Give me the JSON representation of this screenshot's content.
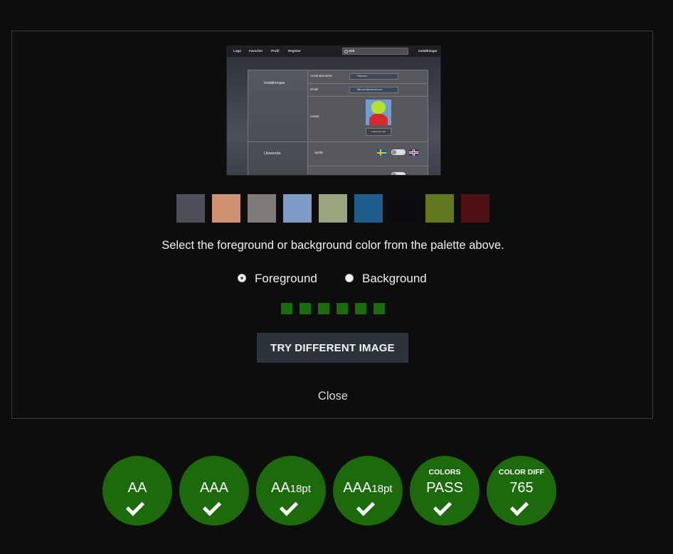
{
  "preview": {
    "nav": [
      "Logo",
      "Favoriter",
      "Profil",
      "Register"
    ],
    "search_value": "Sök",
    "settings_link": "Inställningar",
    "section_settings": "Inställningar",
    "section_appearance": "Utseende",
    "username_label": "Användarnamn",
    "username_value": "Fillmonio",
    "email_label": "Email",
    "email_value": "fillmonio@hotmail.com",
    "avatar_label": "Avatar",
    "avatar_button": "Ladda upp bild",
    "language_label": "Språk"
  },
  "palette": [
    "#4d5157",
    "#d09173",
    "#7f7979",
    "#7c9cc6",
    "#99a57e",
    "#1e5e8c",
    "#0b0c12",
    "#62781e",
    "#4e0f11"
  ],
  "instruction": "Select the foreground or background color from the palette above.",
  "radios": {
    "foreground": "Foreground",
    "background": "Background",
    "selected": "foreground"
  },
  "indicator_count": 6,
  "try_button": "TRY DIFFERENT IMAGE",
  "close": "Close",
  "badges": [
    {
      "label": "AA",
      "suffix": "",
      "sub": "",
      "passed": true
    },
    {
      "label": "AAA",
      "suffix": "",
      "sub": "",
      "passed": true
    },
    {
      "label": "AA",
      "suffix": "18pt",
      "sub": "",
      "passed": true
    },
    {
      "label": "AAA",
      "suffix": "18pt",
      "sub": "",
      "passed": true
    },
    {
      "label": "PASS",
      "suffix": "",
      "sub": "COLORS",
      "passed": true
    },
    {
      "label": "765",
      "suffix": "",
      "sub": "COLOR DIFF",
      "passed": true
    }
  ],
  "colors": {
    "badge": "#1c6a0b",
    "indicator": "#1a6b0c",
    "button": "#2d333b",
    "background": "#0d0d0d"
  }
}
